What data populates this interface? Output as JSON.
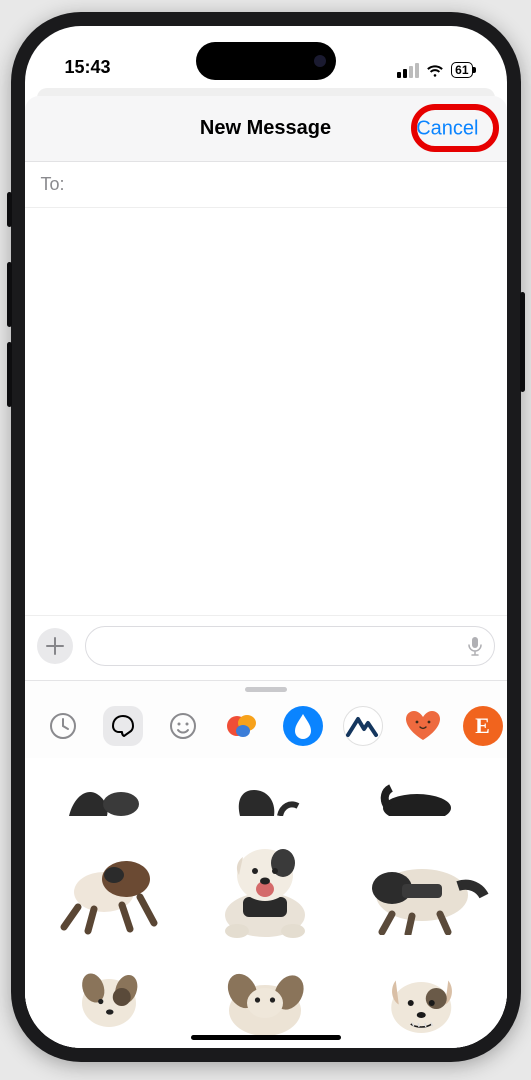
{
  "status": {
    "time": "15:43",
    "battery": "61"
  },
  "nav": {
    "title": "New Message",
    "cancel": "Cancel"
  },
  "compose": {
    "to_label": "To:"
  },
  "drawer": {
    "apps": [
      {
        "name": "recents-icon"
      },
      {
        "name": "stickers-icon"
      },
      {
        "name": "memoji-icon"
      },
      {
        "name": "images-app-icon"
      },
      {
        "name": "drop-app-icon"
      },
      {
        "name": "peaks-app-icon"
      },
      {
        "name": "heart-app-icon"
      },
      {
        "name": "etsy-app-icon"
      }
    ]
  }
}
